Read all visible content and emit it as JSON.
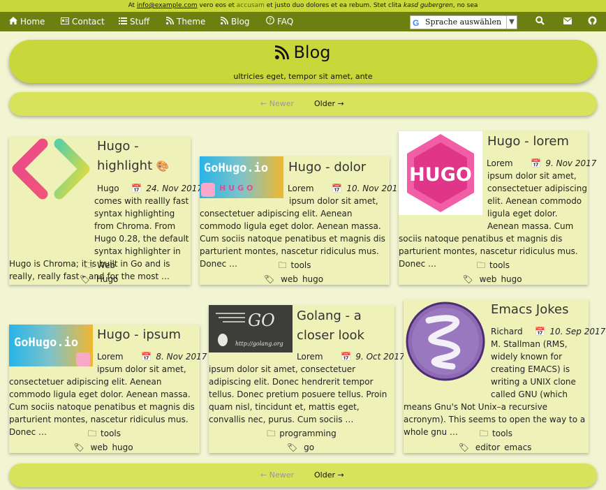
{
  "topbar": {
    "pre": "At ",
    "email": "info@example.com",
    "mid": " vero eos et ",
    "accent": "accusam",
    "rest": " et justo duo dolores et ea rebum. Stet clita ",
    "italic": "kasd gubergren",
    "end": ", no sea"
  },
  "nav": {
    "items": [
      {
        "label": "Home",
        "icon": "home-icon"
      },
      {
        "label": "Contact",
        "icon": "contact-card-icon"
      },
      {
        "label": "Stuff",
        "icon": "list-icon"
      },
      {
        "label": "Theme",
        "icon": "rss-icon"
      },
      {
        "label": "Blog",
        "icon": "rss-icon"
      },
      {
        "label": "FAQ",
        "icon": "question-circle-icon"
      }
    ],
    "translate_label": "Sprache auswählen",
    "right_icons": [
      "search-icon",
      "envelope-icon",
      "github-icon"
    ]
  },
  "hero": {
    "title": "Blog",
    "subtitle": "ultricies eget, tempor sit amet, ante"
  },
  "pager": {
    "newer": "← Newer",
    "older": "Older →"
  },
  "posts": [
    {
      "title": "Hugo - highlight",
      "title_emoji": "🎨",
      "author": "Hugo",
      "date": "24. Nov 2017",
      "excerpt": "comes with reallly fast syntax highlighting from Chroma. From Hugo 0.28, the default syntax highlighter in Hugo is Chroma; it is built in Go and is really, really fast – and for the most …",
      "category": "Web",
      "tags": [
        "Hugo"
      ],
      "image": "code-brackets-logo"
    },
    {
      "title": "Hugo - dolor",
      "author": "Lorem",
      "date": "10. Nov 2017",
      "excerpt": "ipsum dolor sit amet, consectetuer adipiscing elit. Aenean commodo ligula eget dolor. Aenean massa. Cum sociis natoque penatibus et magnis dis parturient montes, nascetur ridiculus mus. Donec …",
      "category": "tools",
      "tags": [
        "web",
        "hugo"
      ],
      "image": "gohugo-banner"
    },
    {
      "title": "Hugo - lorem",
      "author": "Lorem",
      "date": "9. Nov 2017",
      "excerpt": "ipsum dolor sit amet, consectetuer adipiscing elit. Aenean commodo ligula eget dolor. Aenean massa. Cum sociis natoque penatibus et magnis dis parturient montes, nascetur ridiculus mus. Donec …",
      "category": "tools",
      "tags": [
        "web",
        "hugo"
      ],
      "image": "hugo-hexagon-logo",
      "image_text": "HUGO"
    },
    {
      "title": "Hugo - ipsum",
      "author": "Lorem",
      "date": "8. Nov 2017",
      "excerpt": "ipsum dolor sit amet, consectetuer adipiscing elit. Aenean commodo ligula eget dolor. Aenean massa. Cum sociis natoque penatibus et magnis dis parturient montes, nascetur ridiculus mus. Donec …",
      "category": "tools",
      "tags": [
        "web",
        "hugo"
      ],
      "image": "gohugo-banner"
    },
    {
      "title": "Golang - a closer look",
      "author": "Lorem",
      "date": "9. Oct 2017",
      "excerpt": "ipsum dolor sit amet, consectetuer adipiscing elit. Donec hendrerit tempor tellus. Donec pretium posuere tellus. Proin quam nisl, tincidunt et, mattis eget, convallis nec, purus. Cum sociis …",
      "category": "programming",
      "tags": [
        "go"
      ],
      "image": "golang-gopher",
      "image_text": "GO",
      "image_caption": "http://golang.org"
    },
    {
      "title": "Emacs Jokes",
      "author": "Richard",
      "date": "10. Sep 2017",
      "excerpt": "M. Stallman (RMS, widely known for creating EMACS) is writing a UNIX clone called GNU (which means Gnu's Not Unix–a recursive acronym). This seems to open the way to a whole gnu …",
      "category": "tools",
      "tags": [
        "editor",
        "emacs"
      ],
      "image": "emacs-logo"
    }
  ],
  "gohugo_text": "GoHugo.io",
  "gohugo_sub": "HUGO",
  "colors": {
    "nav": "#6e7f12",
    "topbar": "#c9d73a",
    "hero": "#c9d73a",
    "card": "#eef2b8",
    "bg": "#f1f5d2"
  }
}
